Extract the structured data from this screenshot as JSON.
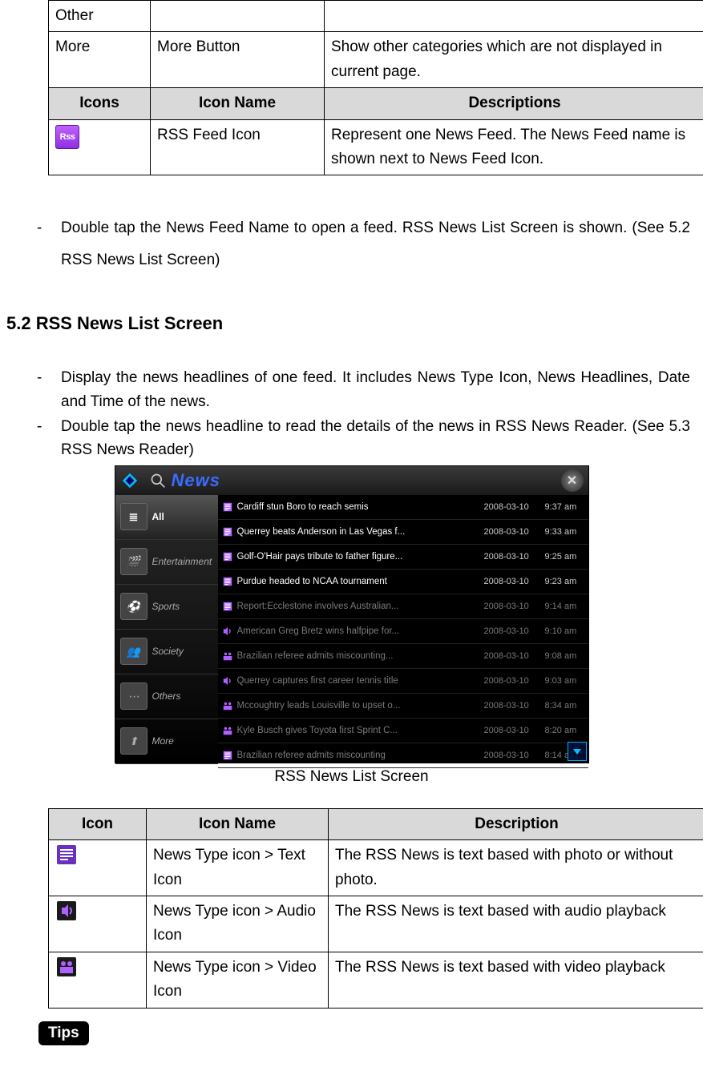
{
  "top_table": {
    "rows": [
      {
        "c1": "Other",
        "c2": "",
        "c3": ""
      },
      {
        "c1": "More",
        "c2": "More Button",
        "c3": "Show other categories which are not displayed in current page."
      }
    ],
    "header": {
      "h1": "Icons",
      "h2": "Icon Name",
      "h3": "Descriptions"
    },
    "row_rss": {
      "c2": "RSS Feed Icon",
      "c3": "Represent one News Feed. The News Feed name is shown next to News Feed Icon.",
      "icon_label": "Rss"
    }
  },
  "body_text": {
    "bullet1": "Double tap the News Feed Name to open a feed. RSS News List Screen is shown.   (See 5.2 RSS News List Screen)",
    "h52": "5.2 RSS News List Screen",
    "bullet2": "Display the news headlines of one feed. It includes News Type Icon, News Headlines, Date and Time of the news.",
    "bullet3": "Double tap the news headline to read the details of the news in RSS News Reader. (See 5.3 RSS News Reader)"
  },
  "screenshot": {
    "title": "News",
    "side": [
      "All",
      "Entertainment",
      "Sports",
      "Society",
      "Others",
      "More"
    ],
    "rows": [
      {
        "icon": "text",
        "title": "Cardiff stun Boro to reach semis",
        "date": "2008-03-10",
        "time": "9:37 am",
        "dim": false
      },
      {
        "icon": "text",
        "title": "Querrey beats Anderson in Las Vegas f...",
        "date": "2008-03-10",
        "time": "9:33 am",
        "dim": false
      },
      {
        "icon": "text",
        "title": "Golf-O'Hair pays tribute to father figure...",
        "date": "2008-03-10",
        "time": "9:25 am",
        "dim": false
      },
      {
        "icon": "text",
        "title": "Purdue headed to NCAA tournament",
        "date": "2008-03-10",
        "time": "9:23 am",
        "dim": false
      },
      {
        "icon": "text",
        "title": "Report:Ecclestone involves Australian...",
        "date": "2008-03-10",
        "time": "9:14 am",
        "dim": true
      },
      {
        "icon": "audio",
        "title": "American Greg Bretz wins halfpipe for...",
        "date": "2008-03-10",
        "time": "9:10 am",
        "dim": true
      },
      {
        "icon": "video",
        "title": "Brazilian referee admits miscounting...",
        "date": "2008-03-10",
        "time": "9:08 am",
        "dim": true
      },
      {
        "icon": "audio",
        "title": "Querrey captures first career tennis title",
        "date": "2008-03-10",
        "time": "9:03 am",
        "dim": true
      },
      {
        "icon": "video",
        "title": "Mccoughtry leads Louisville to upset o...",
        "date": "2008-03-10",
        "time": "8:34 am",
        "dim": true
      },
      {
        "icon": "video",
        "title": "Kyle Busch gives Toyota first Sprint C...",
        "date": "2008-03-10",
        "time": "8:20 am",
        "dim": true
      },
      {
        "icon": "text",
        "title": "Brazilian referee admits miscounting",
        "date": "2008-03-10",
        "time": "8:14 am",
        "dim": true
      }
    ]
  },
  "caption": "RSS News List Screen",
  "bottom_table": {
    "header": {
      "h1": "Icon",
      "h2": "Icon Name",
      "h3": "Description"
    },
    "rows": [
      {
        "name": "News Type icon > Text Icon",
        "desc": "The RSS News is text based with photo or without photo."
      },
      {
        "name": "News Type icon > Audio Icon",
        "desc": "The RSS News is text based with audio playback"
      },
      {
        "name": "News Type icon > Video Icon",
        "desc": "The RSS News is text based with video playback"
      }
    ]
  },
  "tips_label": "Tips"
}
